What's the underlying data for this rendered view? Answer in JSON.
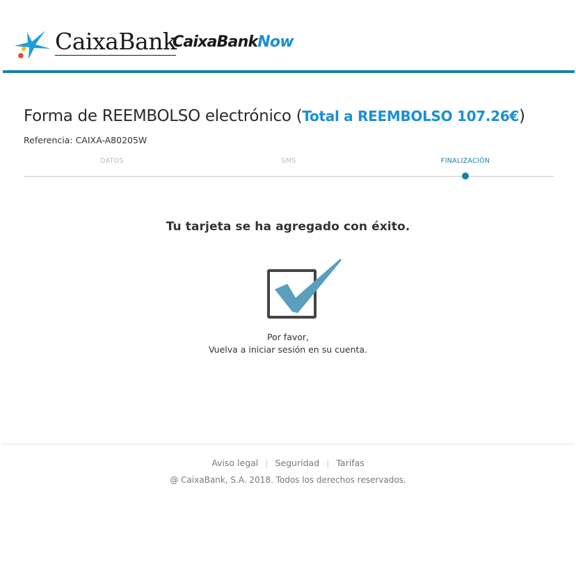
{
  "header": {
    "brand": "CaixaBank",
    "product_part1": "CaixaBank",
    "product_part2": "Now"
  },
  "page": {
    "title": "Forma de REEMBOLSO electrónico",
    "total_label": "Total a REEMBOLSO 107.26€",
    "reference": "Referencia: CAIXA-A80205W"
  },
  "steps": [
    {
      "label": "DATOS"
    },
    {
      "label": "SMS"
    },
    {
      "label": "FINALIZACIÓN"
    }
  ],
  "content": {
    "success_text": "Tu tarjeta se ha agregado con éxito.",
    "message_line1": "Por favor,",
    "message_line2": "Vuelva a iniciar sesión en su cuenta."
  },
  "footer": {
    "links": [
      "Aviso legal",
      "Seguridad",
      "Tarifas"
    ],
    "copyright": "@ CaixaBank, S.A. 2018. Todos los derechos reservados."
  },
  "icons": {
    "logo": "caixabank-star-icon",
    "success": "checkbox-checked-icon"
  },
  "colors": {
    "accent": "#1a7fae",
    "brand_blue": "#1d8fd3",
    "check": "#5a9fbe"
  }
}
